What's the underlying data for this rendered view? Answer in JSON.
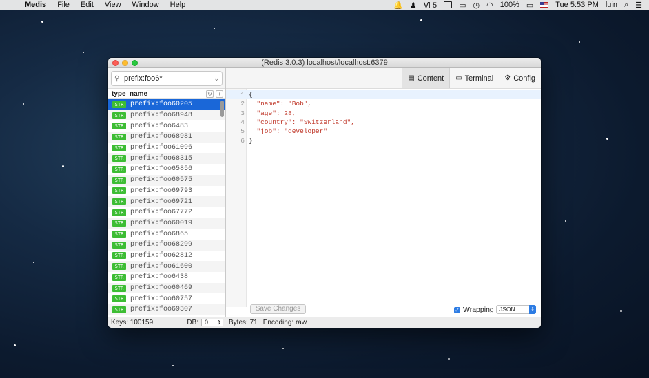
{
  "menubar": {
    "app_name": "Medis",
    "items": [
      "File",
      "Edit",
      "View",
      "Window",
      "Help"
    ],
    "status_number": "5",
    "battery": "100%",
    "clock": "Tue 5:53 PM",
    "user": "luin"
  },
  "window": {
    "title": "(Redis 3.0.3) localhost/localhost:6379"
  },
  "sidebar": {
    "search_value": "prefix:foo6*",
    "col_type": "type",
    "col_name": "name",
    "rows": [
      {
        "type": "STR",
        "name": "prefix:foo60205",
        "selected": true
      },
      {
        "type": "STR",
        "name": "prefix:foo68948"
      },
      {
        "type": "STR",
        "name": "prefix:foo6483"
      },
      {
        "type": "STR",
        "name": "prefix:foo68981"
      },
      {
        "type": "STR",
        "name": "prefix:foo61096"
      },
      {
        "type": "STR",
        "name": "prefix:foo68315"
      },
      {
        "type": "STR",
        "name": "prefix:foo65856"
      },
      {
        "type": "STR",
        "name": "prefix:foo60575"
      },
      {
        "type": "STR",
        "name": "prefix:foo69793"
      },
      {
        "type": "STR",
        "name": "prefix:foo69721"
      },
      {
        "type": "STR",
        "name": "prefix:foo67772"
      },
      {
        "type": "STR",
        "name": "prefix:foo60019"
      },
      {
        "type": "STR",
        "name": "prefix:foo6865"
      },
      {
        "type": "STR",
        "name": "prefix:foo68299"
      },
      {
        "type": "STR",
        "name": "prefix:foo62812"
      },
      {
        "type": "STR",
        "name": "prefix:foo61600"
      },
      {
        "type": "STR",
        "name": "prefix:foo6438"
      },
      {
        "type": "STR",
        "name": "prefix:foo60469"
      },
      {
        "type": "STR",
        "name": "prefix:foo60757"
      },
      {
        "type": "STR",
        "name": "prefix:foo69307"
      }
    ],
    "keys_label": "Keys: 100159",
    "db_label": "DB:",
    "db_value": "0"
  },
  "tabs": {
    "content": "Content",
    "terminal": "Terminal",
    "config": "Config"
  },
  "editor": {
    "lines": [
      {
        "n": "1",
        "text": "{"
      },
      {
        "n": "2",
        "text": "  \"name\": \"Bob\","
      },
      {
        "n": "3",
        "text": "  \"age\": 28,"
      },
      {
        "n": "4",
        "text": "  \"country\": \"Switzerland\","
      },
      {
        "n": "5",
        "text": "  \"job\": \"developer\""
      },
      {
        "n": "6",
        "text": "}"
      }
    ],
    "save_label": "Save Changes",
    "wrapping_label": "Wrapping",
    "wrapping_checked": true,
    "format_value": "JSON"
  },
  "status": {
    "bytes": "Bytes: 71",
    "encoding": "Encoding: raw"
  },
  "colors": {
    "selection": "#1a67d8",
    "badge_str": "#3dbd34",
    "code_string": "#c0392b",
    "code_number": "#b05a00"
  }
}
